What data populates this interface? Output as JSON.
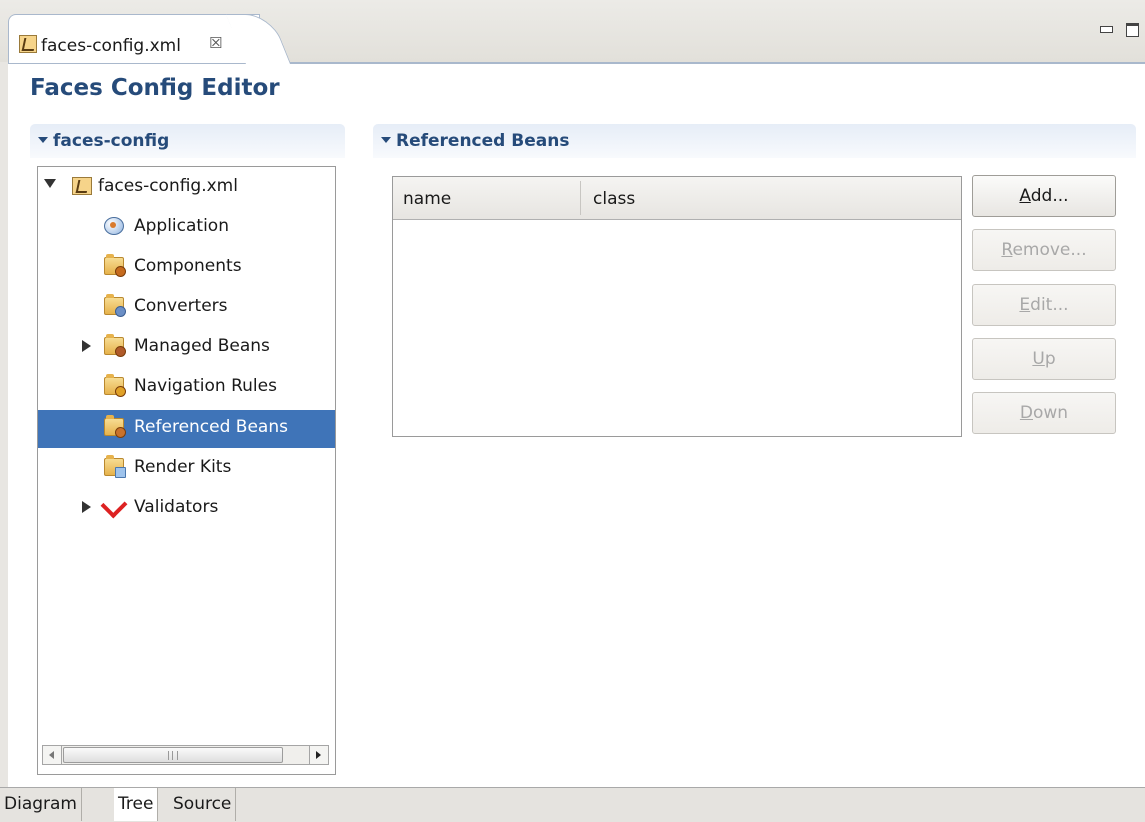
{
  "editor_tab": {
    "title": "faces-config.xml",
    "close_glyph": "☒",
    "icon": "faces-config-file-icon"
  },
  "window_controls": {
    "minimize": "minimize-icon",
    "maximize": "maximize-icon"
  },
  "editor_title": "Faces Config Editor",
  "left_section": {
    "title": "faces-config"
  },
  "tree": {
    "root": {
      "label": "faces-config.xml",
      "expanded": true
    },
    "items": [
      {
        "label": "Application",
        "icon": "application-icon",
        "expandable": false,
        "selected": false
      },
      {
        "label": "Components",
        "icon": "components-folder-icon",
        "expandable": false,
        "selected": false
      },
      {
        "label": "Converters",
        "icon": "converters-folder-icon",
        "expandable": false,
        "selected": false
      },
      {
        "label": "Managed Beans",
        "icon": "managed-beans-folder-icon",
        "expandable": true,
        "selected": false
      },
      {
        "label": "Navigation Rules",
        "icon": "navigation-rules-folder-icon",
        "expandable": false,
        "selected": false
      },
      {
        "label": "Referenced Beans",
        "icon": "referenced-beans-folder-icon",
        "expandable": false,
        "selected": true
      },
      {
        "label": "Render Kits",
        "icon": "render-kits-folder-icon",
        "expandable": false,
        "selected": false
      },
      {
        "label": "Validators",
        "icon": "validators-check-icon",
        "expandable": true,
        "selected": false
      }
    ],
    "scrollbar_grip": "III"
  },
  "right_section": {
    "title": "Referenced Beans",
    "table": {
      "columns": [
        "name",
        "class"
      ],
      "rows": []
    },
    "buttons": {
      "add": {
        "mnemonic": "A",
        "rest": "dd...",
        "enabled": true
      },
      "remove": {
        "mnemonic": "R",
        "rest": "emove...",
        "enabled": false
      },
      "edit": {
        "mnemonic": "E",
        "rest": "dit...",
        "enabled": false
      },
      "up": {
        "mnemonic": "U",
        "rest": "p",
        "enabled": false
      },
      "down": {
        "mnemonic": "D",
        "rest": "own",
        "enabled": false
      }
    }
  },
  "bottom_tabs": [
    {
      "label": "Diagram",
      "active": false
    },
    {
      "label": "Tree",
      "active": true
    },
    {
      "label": "Source",
      "active": false
    }
  ],
  "colors": {
    "header_text": "#264b7a",
    "selection": "#3f74b8"
  }
}
